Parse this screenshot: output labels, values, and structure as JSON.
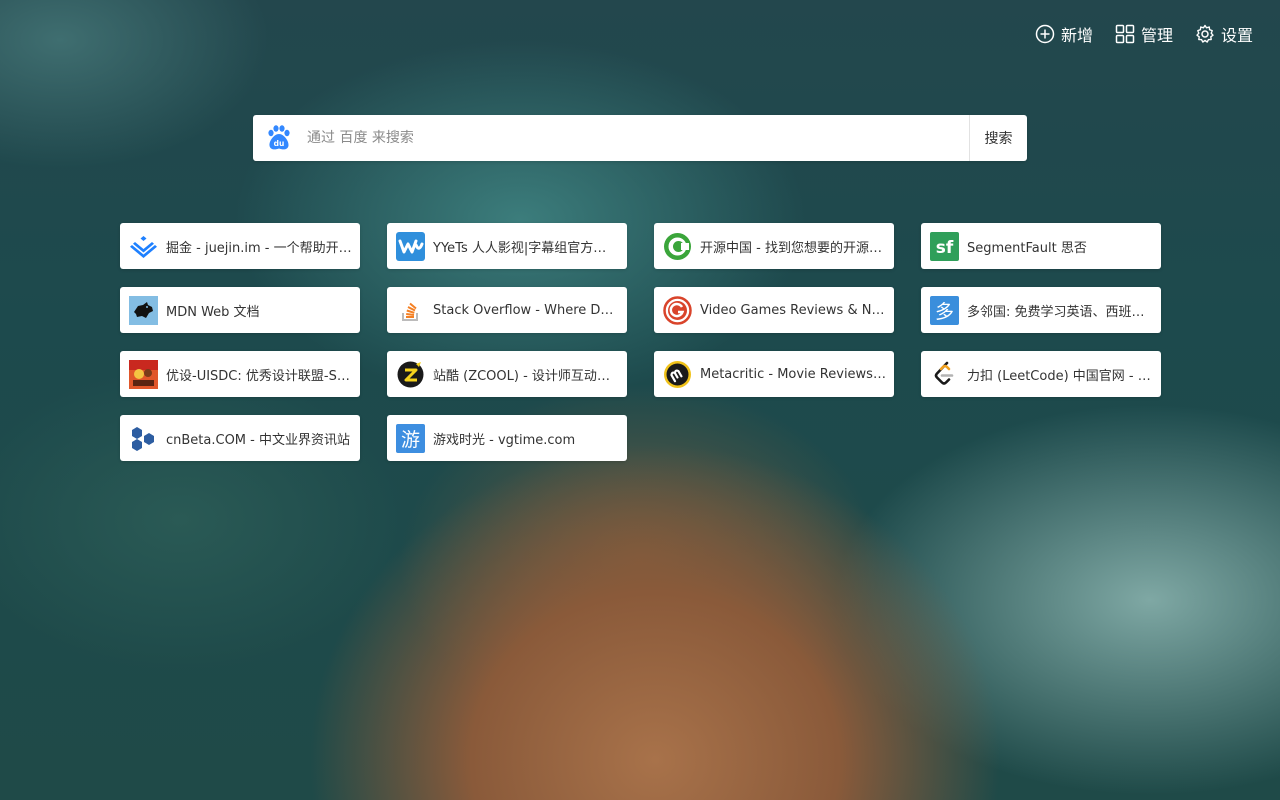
{
  "toolbar": {
    "add_label": "新增",
    "manage_label": "管理",
    "settings_label": "设置"
  },
  "search": {
    "placeholder": "通过 百度 来搜索",
    "button_label": "搜索",
    "engine_icon": "baidu-paw-icon"
  },
  "bookmarks": [
    {
      "label": "掘金 - juejin.im - 一个帮助开发者成长的社区",
      "icon": "juejin-icon",
      "color": "#1e80ff"
    },
    {
      "label": "YYeTs 人人影视|字幕组官方下载",
      "icon": "yyets-icon",
      "color": "#2f8fdc"
    },
    {
      "label": "开源中国 - 找到您想要的开源项目",
      "icon": "oschina-icon",
      "color": "#3aa53a"
    },
    {
      "label": "SegmentFault 思否",
      "icon": "segmentfault-icon",
      "color": "#2f9f5a"
    },
    {
      "label": "MDN Web 文档",
      "icon": "mdn-icon",
      "color": "#83bde3"
    },
    {
      "label": "Stack Overflow - Where Developers Learn",
      "icon": "stackoverflow-icon",
      "color": "#f48024"
    },
    {
      "label": "Video Games Reviews & News - GameSpot",
      "icon": "gamespot-icon",
      "color": "#d9442b"
    },
    {
      "label": "多邻国: 免费学习英语、西班牙语",
      "icon": "duolingo-icon",
      "color": "#3a8edc"
    },
    {
      "label": "优设-UISDC: 优秀设计联盟-SDC",
      "icon": "uisdc-icon",
      "color": "#e0562a"
    },
    {
      "label": "站酷 (ZCOOL) - 设计师互动平台",
      "icon": "zcool-icon",
      "color": "#1a1a1a"
    },
    {
      "label": "Metacritic - Movie Reviews, TV Reviews",
      "icon": "metacritic-icon",
      "color": "#f0c21a"
    },
    {
      "label": "力扣 (LeetCode) 中国官网 - 全球极客挚爱",
      "icon": "leetcode-icon",
      "color": "#f0a01e"
    },
    {
      "label": "cnBeta.COM - 中文业界资讯站",
      "icon": "cnbeta-icon",
      "color": "#2d5da1"
    },
    {
      "label": "游戏时光 - vgtime.com",
      "icon": "vgtime-icon",
      "color": "#3d8ee0"
    }
  ],
  "icon_glyphs": {
    "duolingo": "多",
    "vgtime": "游",
    "segmentfault": "sf"
  }
}
